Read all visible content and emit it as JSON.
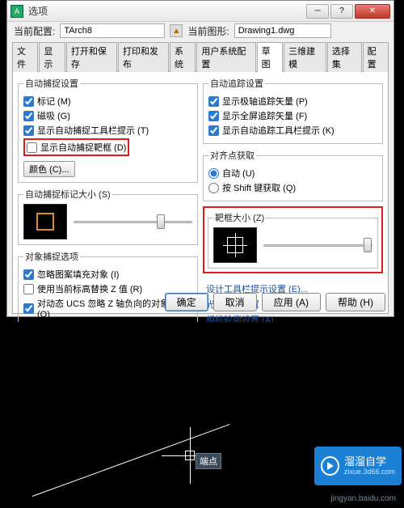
{
  "window": {
    "title": "选项"
  },
  "header": {
    "config_label": "当前配置:",
    "config_value": "TArch8",
    "drawing_label": "当前图形:",
    "drawing_value": "Drawing1.dwg"
  },
  "tabs": [
    "文件",
    "显示",
    "打开和保存",
    "打印和发布",
    "系统",
    "用户系统配置",
    "草图",
    "三维建模",
    "选择集",
    "配置"
  ],
  "active_tab": "草图",
  "left": {
    "snap_group": "自动捕捉设置",
    "mark": "标记 (M)",
    "magnet": "磁吸 (G)",
    "tooltip": "显示自动捕捉工具栏提示 (T)",
    "aperture_box": "显示自动捕捉靶框 (D)",
    "color_btn": "颜色 (C)...",
    "size_group": "自动捕捉标记大小 (S)",
    "obj_group": "对象捕捉选项",
    "ignore_hatch": "忽略图案填充对象 (I)",
    "replace_z": "使用当前标高替换 Z 值 (R)",
    "dyn_ucs": "对动态 UCS 忽略 Z 轴负向的对象捕捉 (O)"
  },
  "right": {
    "track_group": "自动追踪设置",
    "polar_vec": "显示极轴追踪矢量 (P)",
    "full_vec": "显示全屏追踪矢量 (F)",
    "track_tip": "显示自动追踪工具栏提示 (K)",
    "align_group": "对齐点获取",
    "auto": "自动 (U)",
    "shift": "按 Shift 键获取 (Q)",
    "aperture_group": "靶框大小 (Z)",
    "design_tip": "设计工具栏提示设置 (E)...",
    "light_outline": "光线轮廓设置 (L)...",
    "camera_outline": "相机轮廓设置 (A)..."
  },
  "buttons": {
    "ok": "确定",
    "cancel": "取消",
    "apply": "应用 (A)",
    "help": "帮助 (H)"
  },
  "canvas": {
    "snap_tooltip": "端点"
  },
  "brand": {
    "title": "溜溜自学",
    "sub": "zixue.3d66.com"
  },
  "watermark": "jingyan.baidu.com"
}
